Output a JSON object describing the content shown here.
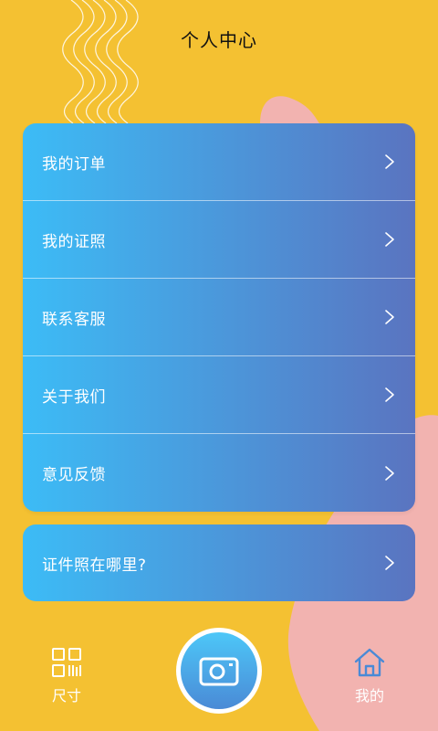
{
  "header": {
    "title": "个人中心"
  },
  "menu": {
    "items": [
      {
        "label": "我的订单"
      },
      {
        "label": "我的证照"
      },
      {
        "label": "联系客服"
      },
      {
        "label": "关于我们"
      },
      {
        "label": "意见反馈"
      }
    ]
  },
  "faq": {
    "label": "证件照在哪里?"
  },
  "tabbar": {
    "size_label": "尺寸",
    "mine_label": "我的"
  },
  "colors": {
    "background": "#f4c132",
    "blob": "#f2b3b0",
    "card_start": "#3cbcf6",
    "card_end": "#5a74c0",
    "active_tab": "#4a8ad6"
  },
  "icons": [
    "qr-grid-icon",
    "camera-icon",
    "home-icon",
    "chevron-right-icon"
  ]
}
